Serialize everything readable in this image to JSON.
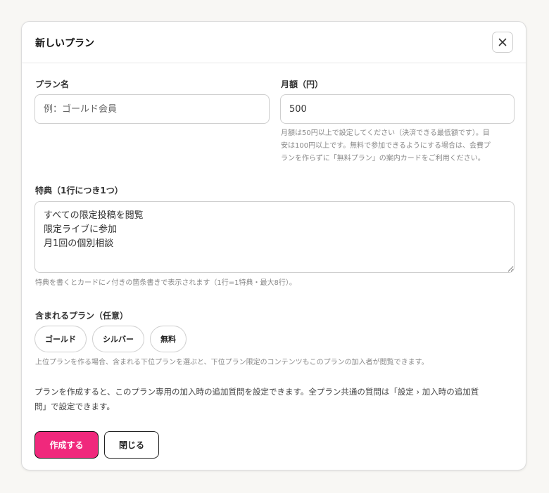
{
  "modal": {
    "title": "新しいプラン",
    "close_icon": "close-icon"
  },
  "form": {
    "plan_name": {
      "label": "プラン名",
      "placeholder": "例：ゴールド会員",
      "value": ""
    },
    "monthly_price": {
      "label": "月額（円）",
      "value": "500",
      "help_lines": [
        "月額は50円以上で設定してください（決済できる最低額です）。目",
        "安は100円以上です。無料で参加できるようにする場合は、会費プ",
        "ランを作らずに「無料プラン」の案内カードをご利用ください。"
      ]
    },
    "benefits": {
      "label": "特典（1行につき1つ）",
      "value": "すべての限定投稿を閲覧\n限定ライブに参加\n月1回の個別相談",
      "help": "特典を書くとカードに✓付きの箇条書きで表示されます（1行=1特典・最大8行）。"
    },
    "included_plans": {
      "label": "含まれるプラン（任意）",
      "options": [
        "ゴールド",
        "シルバー",
        "無料"
      ],
      "help": "上位プランを作る場合、含まれる下位プランを選ぶと、下位プラン限定のコンテンツもこのプランの加入者が閲覧できます。"
    },
    "note_lines": [
      "プランを作成すると、このプラン専用の加入時の追加質問を設定できます。全プラン共通の質問は「設定 › 加入時の追加質",
      "問」で設定できます。"
    ]
  },
  "actions": {
    "create_label": "作成する",
    "close_label": "閉じる"
  },
  "colors": {
    "accent": "#f0287c",
    "background": "#f8f7f4"
  }
}
